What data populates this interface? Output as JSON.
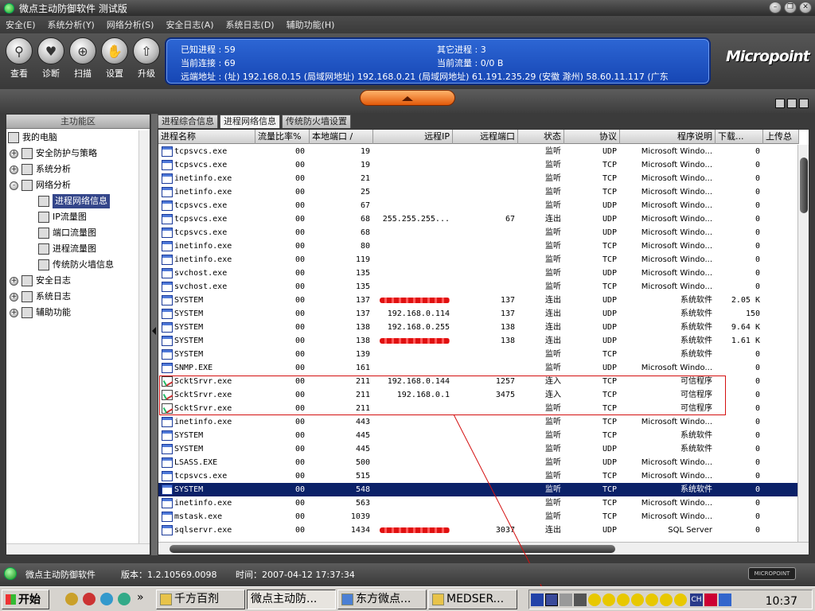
{
  "window": {
    "title": "微点主动防御软件  测试版"
  },
  "menu": [
    "安全(E)",
    "系统分析(Y)",
    "网络分析(S)",
    "安全日志(A)",
    "系统日志(D)",
    "辅助功能(H)"
  ],
  "toolbar": {
    "buttons": [
      {
        "label": "查看",
        "icon": "magnifier-icon"
      },
      {
        "label": "诊断",
        "icon": "diagnose-icon"
      },
      {
        "label": "扫描",
        "icon": "scan-icon"
      },
      {
        "label": "设置",
        "icon": "settings-icon"
      },
      {
        "label": "升级",
        "icon": "upgrade-icon"
      }
    ]
  },
  "info": {
    "known_processes": "已知进程 : 59",
    "other_processes": "其它进程 : 3",
    "current_connections": "当前连接 : 69",
    "current_traffic": "当前流量 : 0/0 B",
    "remote_addresses": "远端地址 : (址)   192.168.0.15 (局域网地址)   192.168.0.21 (局域网地址)   61.191.235.29 (安徽 滁州)   58.60.11.117 (广东"
  },
  "logo": "Micropoint",
  "left_panel": {
    "header": "主功能区",
    "tree": [
      {
        "label": "我的电脑",
        "level": 0,
        "pm": "",
        "icon": "computer-icon"
      },
      {
        "label": "安全防护与策略",
        "level": 1,
        "pm": "+",
        "icon": "shield-policy-icon"
      },
      {
        "label": "系统分析",
        "level": 1,
        "pm": "+",
        "icon": "system-analysis-icon"
      },
      {
        "label": "网络分析",
        "level": 1,
        "pm": "-",
        "icon": "network-icon"
      },
      {
        "label": "进程网络信息",
        "level": 2,
        "pm": "",
        "icon": "process-network-icon",
        "selected": true
      },
      {
        "label": "IP流量图",
        "level": 2,
        "pm": "",
        "icon": "ip-traffic-icon"
      },
      {
        "label": "端口流量图",
        "level": 2,
        "pm": "",
        "icon": "port-traffic-icon"
      },
      {
        "label": "进程流量图",
        "level": 2,
        "pm": "",
        "icon": "process-traffic-icon"
      },
      {
        "label": "传统防火墙信息",
        "level": 2,
        "pm": "",
        "icon": "firewall-icon"
      },
      {
        "label": "安全日志",
        "level": 1,
        "pm": "+",
        "icon": "security-log-icon"
      },
      {
        "label": "系统日志",
        "level": 1,
        "pm": "+",
        "icon": "system-log-icon"
      },
      {
        "label": "辅助功能",
        "level": 1,
        "pm": "+",
        "icon": "helper-icon"
      }
    ]
  },
  "tabs": [
    "进程综合信息",
    "进程网络信息",
    "传统防火墙设置"
  ],
  "grid": {
    "columns": [
      "进程名称",
      "流量比率%",
      "本地端口 /",
      "远程IP",
      "远程端口",
      "状态",
      "协议",
      "程序说明",
      "下载...",
      "上传总"
    ],
    "rows": [
      [
        "tcpsvcs.exe",
        "00",
        "19",
        "",
        "",
        "监听",
        "UDP",
        "Microsoft Windo...",
        "0",
        "",
        ""
      ],
      [
        "tcpsvcs.exe",
        "00",
        "19",
        "",
        "",
        "监听",
        "TCP",
        "Microsoft Windo...",
        "0",
        "",
        ""
      ],
      [
        "inetinfo.exe",
        "00",
        "21",
        "",
        "",
        "监听",
        "TCP",
        "Microsoft Windo...",
        "0",
        "",
        ""
      ],
      [
        "inetinfo.exe",
        "00",
        "25",
        "",
        "",
        "监听",
        "TCP",
        "Microsoft Windo...",
        "0",
        "",
        ""
      ],
      [
        "tcpsvcs.exe",
        "00",
        "67",
        "",
        "",
        "监听",
        "UDP",
        "Microsoft Windo...",
        "0",
        "",
        ""
      ],
      [
        "tcpsvcs.exe",
        "00",
        "68",
        "255.255.255...",
        "67",
        "连出",
        "UDP",
        "Microsoft Windo...",
        "0",
        "",
        ""
      ],
      [
        "tcpsvcs.exe",
        "00",
        "68",
        "",
        "",
        "监听",
        "UDP",
        "Microsoft Windo...",
        "0",
        "",
        ""
      ],
      [
        "inetinfo.exe",
        "00",
        "80",
        "",
        "",
        "监听",
        "TCP",
        "Microsoft Windo...",
        "0",
        "",
        ""
      ],
      [
        "inetinfo.exe",
        "00",
        "119",
        "",
        "",
        "监听",
        "TCP",
        "Microsoft Windo...",
        "0",
        "",
        ""
      ],
      [
        "svchost.exe",
        "00",
        "135",
        "",
        "",
        "监听",
        "UDP",
        "Microsoft Windo...",
        "0",
        "",
        ""
      ],
      [
        "svchost.exe",
        "00",
        "135",
        "",
        "",
        "监听",
        "TCP",
        "Microsoft Windo...",
        "0",
        "",
        ""
      ],
      [
        "SYSTEM",
        "00",
        "137",
        "",
        "137",
        "连出",
        "UDP",
        "系统软件",
        "2.05 K",
        "",
        "scribble"
      ],
      [
        "SYSTEM",
        "00",
        "137",
        "192.168.0.114",
        "137",
        "连出",
        "UDP",
        "系统软件",
        "150",
        "",
        ""
      ],
      [
        "SYSTEM",
        "00",
        "138",
        "192.168.0.255",
        "138",
        "连出",
        "UDP",
        "系统软件",
        "9.64 K",
        "",
        ""
      ],
      [
        "SYSTEM",
        "00",
        "138",
        "",
        "138",
        "连出",
        "UDP",
        "系统软件",
        "1.61 K",
        "",
        "scribble"
      ],
      [
        "SYSTEM",
        "00",
        "139",
        "",
        "",
        "监听",
        "TCP",
        "系统软件",
        "0",
        "",
        ""
      ],
      [
        "SNMP.EXE",
        "00",
        "161",
        "",
        "",
        "监听",
        "UDP",
        "Microsoft Windo...",
        "0",
        "",
        ""
      ],
      [
        "ScktSrvr.exe",
        "00",
        "211",
        "192.168.0.144",
        "1257",
        "连入",
        "TCP",
        "可信程序",
        "0",
        "trusted",
        ""
      ],
      [
        "ScktSrvr.exe",
        "00",
        "211",
        "192.168.0.1",
        "3475",
        "连入",
        "TCP",
        "可信程序",
        "0",
        "trusted",
        ""
      ],
      [
        "ScktSrvr.exe",
        "00",
        "211",
        "",
        "",
        "监听",
        "TCP",
        "可信程序",
        "0",
        "trusted",
        ""
      ],
      [
        "inetinfo.exe",
        "00",
        "443",
        "",
        "",
        "监听",
        "TCP",
        "Microsoft Windo...",
        "0",
        "",
        ""
      ],
      [
        "SYSTEM",
        "00",
        "445",
        "",
        "",
        "监听",
        "TCP",
        "系统软件",
        "0",
        "",
        ""
      ],
      [
        "SYSTEM",
        "00",
        "445",
        "",
        "",
        "监听",
        "UDP",
        "系统软件",
        "0",
        "",
        ""
      ],
      [
        "LSASS.EXE",
        "00",
        "500",
        "",
        "",
        "监听",
        "UDP",
        "Microsoft Windo...",
        "0",
        "",
        ""
      ],
      [
        "tcpsvcs.exe",
        "00",
        "515",
        "",
        "",
        "监听",
        "TCP",
        "Microsoft Windo...",
        "0",
        "",
        ""
      ],
      [
        "SYSTEM",
        "00",
        "548",
        "",
        "",
        "监听",
        "TCP",
        "系统软件",
        "0",
        "",
        "selected"
      ],
      [
        "inetinfo.exe",
        "00",
        "563",
        "",
        "",
        "监听",
        "TCP",
        "Microsoft Windo...",
        "0",
        "",
        ""
      ],
      [
        "mstask.exe",
        "00",
        "1039",
        "",
        "",
        "监听",
        "TCP",
        "Microsoft Windo...",
        "0",
        "",
        ""
      ],
      [
        "sqlservr.exe",
        "00",
        "1434",
        "",
        "3037",
        "连出",
        "UDP",
        "SQL Server",
        "0",
        "",
        "scribble"
      ]
    ]
  },
  "status": {
    "app": "微点主动防御软件",
    "version": "版本：1.2.10569.0098",
    "time": "时间：2007-04-12 17:37:34",
    "brand": "MICROPOINT"
  },
  "taskbar": {
    "start": "开始",
    "tasks": [
      "千方百剂",
      "微点主动防...",
      "东方微点...",
      "MEDSER..."
    ],
    "clock": "10:37"
  },
  "colors": {
    "panel_blue": "#1e54c6",
    "selection": "#0b2168",
    "annotation_red": "#d41010"
  }
}
